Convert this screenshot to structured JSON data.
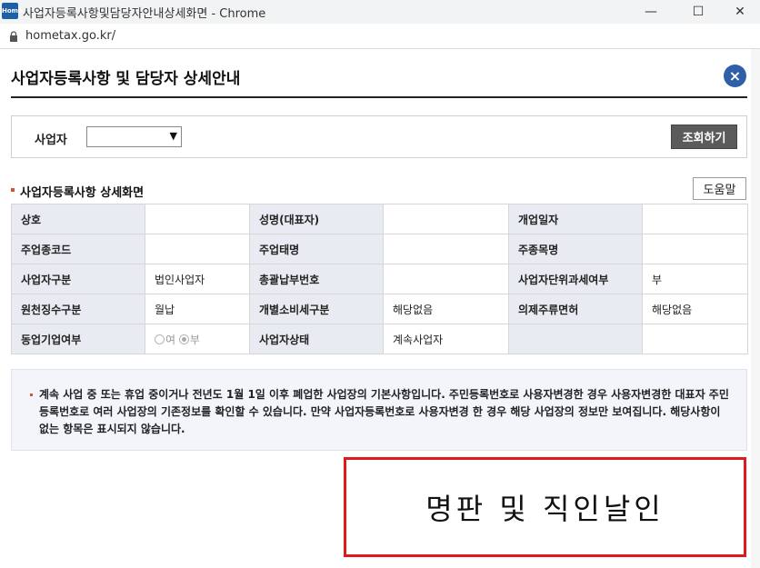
{
  "window": {
    "title": "사업자등록사항및담당자안내상세화면 - Chrome",
    "app_icon_text": "Home",
    "url": "hometax.go.kr/",
    "controls": {
      "minimize": "—",
      "maximize": "☐",
      "close": "✕"
    }
  },
  "page": {
    "title": "사업자등록사항 및 담당자 상세안내",
    "close_glyph": "×"
  },
  "search": {
    "label": "사업자",
    "select_value": "",
    "query_button": "조회하기"
  },
  "section": {
    "title": "사업자등록사항 상세화면",
    "help_button": "도움말"
  },
  "table": {
    "rows": [
      [
        {
          "label": "상호",
          "value": ""
        },
        {
          "label": "성명(대표자)",
          "value": ""
        },
        {
          "label": "개업일자",
          "value": ""
        }
      ],
      [
        {
          "label": "주업종코드",
          "value": ""
        },
        {
          "label": "주업태명",
          "value": ""
        },
        {
          "label": "주종목명",
          "value": ""
        }
      ],
      [
        {
          "label": "사업자구분",
          "value": "법인사업자"
        },
        {
          "label": "총괄납부번호",
          "value": ""
        },
        {
          "label": "사업자단위과세여부",
          "value": "부"
        }
      ],
      [
        {
          "label": "원천징수구분",
          "value": "월납"
        },
        {
          "label": "개별소비세구분",
          "value": "해당없음"
        },
        {
          "label": "의제주류면허",
          "value": "해당없음"
        }
      ],
      [
        {
          "label": "동업기업여부",
          "value": ""
        },
        {
          "label": "사업자상태",
          "value": "계속사업자"
        },
        {
          "label": "",
          "value": ""
        }
      ]
    ],
    "radio": {
      "option_yes": "여",
      "option_no": "부",
      "selected": "부"
    }
  },
  "notice": {
    "text": "계속 사업 중 또는 휴업 중이거나 전년도 1월 1일 이후 폐업한 사업장의 기본사항입니다. 주민등록번호로 사용자변경한 경우 사용자변경한 대표자 주민등록번호로 여러 사업장의 기존정보를 확인할 수 있습니다. 만약 사업자등록번호로 사용자변경 한 경우 해당 사업장의 정보만 보여집니다. 해당사항이 없는 항목은 표시되지 않습니다."
  },
  "stamp": {
    "text": "명판 및 직인날인",
    "border_color": "#e01a1a"
  },
  "colors": {
    "accent": "#2f5fa9",
    "header_cell": "#e8ebf1",
    "button_dark": "#5b5b5b"
  }
}
